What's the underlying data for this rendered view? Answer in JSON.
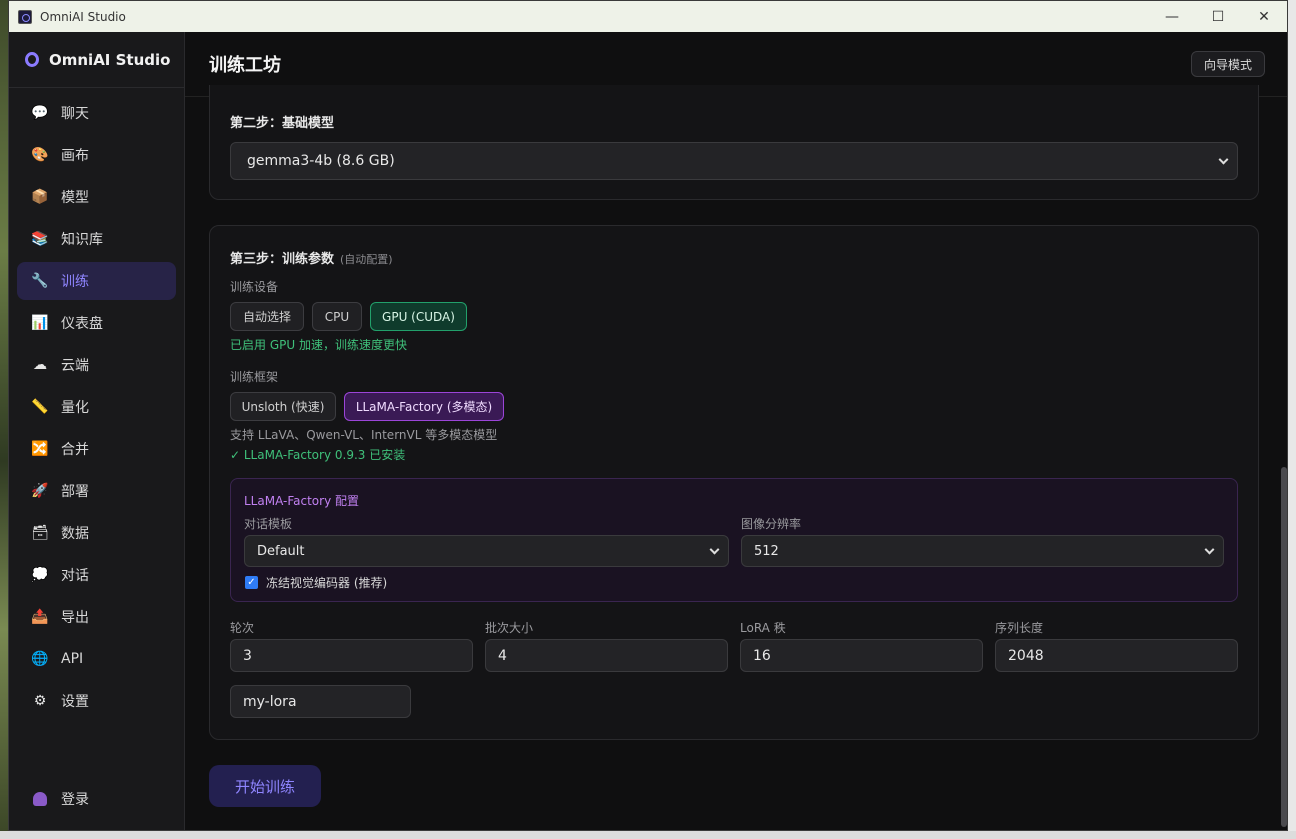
{
  "window": {
    "title": "OmniAI Studio",
    "minimize": "—",
    "maximize": "☐",
    "close": "✕"
  },
  "sidebar": {
    "brand": "OmniAI Studio",
    "items": [
      {
        "label": "聊天",
        "icon": "speech-bubble-icon",
        "glyph": "💬"
      },
      {
        "label": "画布",
        "icon": "palette-icon",
        "glyph": "🎨"
      },
      {
        "label": "模型",
        "icon": "package-icon",
        "glyph": "📦"
      },
      {
        "label": "知识库",
        "icon": "books-icon",
        "glyph": "📚"
      },
      {
        "label": "训练",
        "icon": "wrench-icon",
        "glyph": "🔧",
        "active": true
      },
      {
        "label": "仪表盘",
        "icon": "bar-chart-icon",
        "glyph": "📊"
      },
      {
        "label": "云端",
        "icon": "cloud-icon",
        "glyph": "☁"
      },
      {
        "label": "量化",
        "icon": "calipers-icon",
        "glyph": "📏"
      },
      {
        "label": "合并",
        "icon": "shuffle-icon",
        "glyph": "🔀"
      },
      {
        "label": "部署",
        "icon": "rocket-icon",
        "glyph": "🚀"
      },
      {
        "label": "数据",
        "icon": "inbox-tray-icon",
        "glyph": "🗃"
      },
      {
        "label": "对话",
        "icon": "thought-bubble-icon",
        "glyph": "💭"
      },
      {
        "label": "导出",
        "icon": "outbox-icon",
        "glyph": "📤"
      },
      {
        "label": "API",
        "icon": "globe-icon",
        "glyph": "🌐"
      },
      {
        "label": "设置",
        "icon": "gear-icon",
        "glyph": "⚙"
      }
    ],
    "login": "登录"
  },
  "header": {
    "title": "训练工坊",
    "wizard_button": "向导模式"
  },
  "step2": {
    "title": "第二步：基础模型",
    "model_selected": "gemma3-4b (8.6 GB)"
  },
  "step3": {
    "title": "第三步：训练参数",
    "subtitle": "(自动配置)",
    "device_label": "训练设备",
    "devices": [
      "自动选择",
      "CPU",
      "GPU (CUDA)"
    ],
    "device_selected": "GPU (CUDA)",
    "device_note": "已启用 GPU 加速，训练速度更快",
    "framework_label": "训练框架",
    "frameworks": [
      "Unsloth (快速)",
      "LLaMA-Factory (多模态)"
    ],
    "framework_selected": "LLaMA-Factory (多模态)",
    "framework_desc": "支持 LLaVA、Qwen-VL、InternVL 等多模态模型",
    "framework_installed": "✓ LLaMA-Factory 0.9.3 已安装",
    "llama_config": {
      "title": "LLaMA-Factory 配置",
      "template_label": "对话模板",
      "template_value": "Default",
      "resolution_label": "图像分辨率",
      "resolution_value": "512",
      "freeze_label": "冻结视觉编码器 (推荐)",
      "freeze_checked": true
    },
    "params": {
      "epochs_label": "轮次",
      "epochs": "3",
      "batch_label": "批次大小",
      "batch": "4",
      "lora_label": "LoRA 秩",
      "lora": "16",
      "seq_label": "序列长度",
      "seq": "2048"
    },
    "output_name": "my-lora"
  },
  "start_button": "开始训练",
  "colors": {
    "accent": "#8f85ff",
    "gpu_green": "#22a06b",
    "llama_purple": "#9b45d8"
  }
}
